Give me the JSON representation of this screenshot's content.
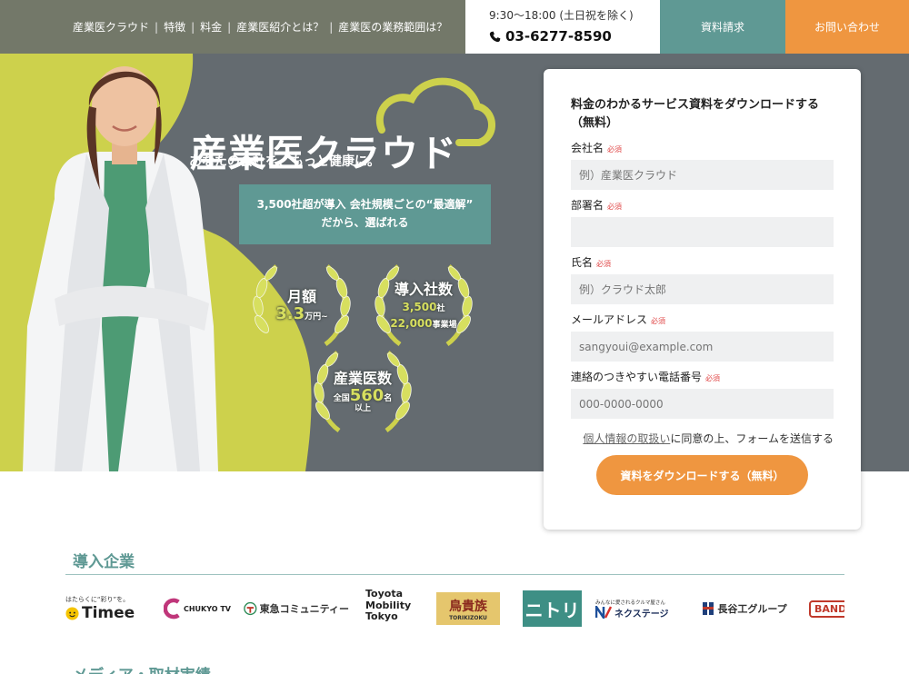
{
  "nav": {
    "items": [
      "産業医クラウド",
      "特徴",
      "料金",
      "産業医紹介とは？",
      "産業医の業務範囲は？"
    ],
    "separator": "|"
  },
  "header": {
    "hours": "9:30〜18:00 (土日祝を除く)",
    "phone": "03-6277-8590",
    "doc_button": "資料請求",
    "contact_button": "お問い合わせ"
  },
  "hero": {
    "logo": "産業医クラウド",
    "tagline": "あなたの会社を、もっと健康に。",
    "promo_line1": "3,500社超が導入 会社規模ごとの“最適解”",
    "promo_line2": "だから、選ばれる",
    "badges": [
      {
        "title": "月額",
        "value": "3.3",
        "unit": "万円~"
      },
      {
        "title": "導入社数",
        "line1": "3,500",
        "line1_unit": "社",
        "line2": "22,000",
        "line2_unit": "事業場"
      },
      {
        "title": "産業医数",
        "prefix": "全国",
        "value": "560",
        "unit": "名",
        "suffix": "以上"
      }
    ]
  },
  "form": {
    "title": "料金のわかるサービス資料をダウンロードする（無料）",
    "required": "必須",
    "fields": [
      {
        "label": "会社名",
        "placeholder": "例）産業医クラウド"
      },
      {
        "label": "部署名",
        "placeholder": ""
      },
      {
        "label": "氏名",
        "placeholder": "例）クラウド太郎"
      },
      {
        "label": "メールアドレス",
        "placeholder": "sangyoui@example.com"
      },
      {
        "label": "連絡のつきやすい電話番号",
        "placeholder": "000-0000-0000"
      }
    ],
    "privacy_link": "個人情報の取扱い",
    "privacy_text": "に同意の上、フォームを送信する",
    "submit": "資料をダウンロードする（無料）"
  },
  "clients": {
    "title": "導入企業",
    "logos": [
      {
        "name": "Timee",
        "sub": "はたらくに“彩り”を。"
      },
      {
        "name": "CHUKYO TV"
      },
      {
        "name": "東急コミュニティー"
      },
      {
        "name": "Toyota Mobility Tokyo"
      },
      {
        "name": "鳥貴族",
        "sub": "TORIKIZOKU"
      },
      {
        "name": "ニトリ"
      },
      {
        "name": "ネクステージ",
        "sub": "みんなに愛されるクルマ屋さん"
      },
      {
        "name": "長谷工グループ"
      },
      {
        "name": "BAND"
      }
    ]
  },
  "next_section": {
    "title": "メディア・取材実績"
  },
  "colors": {
    "teal": "#5f9994",
    "orange": "#ef9640",
    "lime": "#cdd14c",
    "hero_bg": "#646b70"
  }
}
